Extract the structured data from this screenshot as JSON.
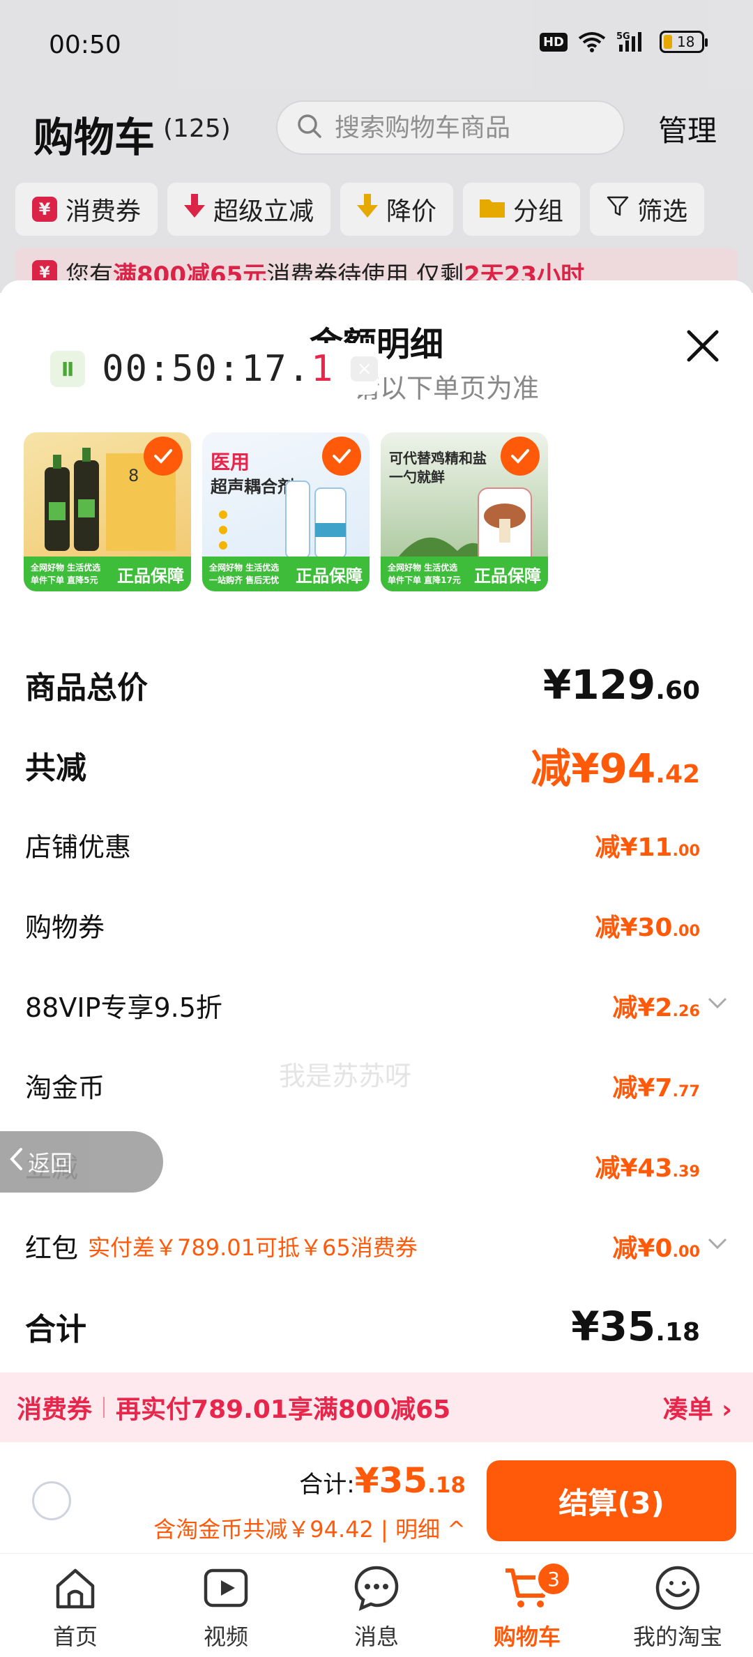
{
  "status": {
    "time": "00:50",
    "hd": "HD",
    "net": "5G",
    "battery": "18"
  },
  "header": {
    "title": "购物车",
    "count": "(125)",
    "search_placeholder": "搜索购物车商品",
    "manage": "管理"
  },
  "filters": [
    {
      "label": "消费券",
      "icon": "coupon-icon",
      "color": "#e8264b"
    },
    {
      "label": "超级立减",
      "icon": "arrow-down-icon",
      "color": "#e8264b"
    },
    {
      "label": "降价",
      "icon": "arrow-down-icon",
      "color": "#f4b400"
    },
    {
      "label": "分组",
      "icon": "folder-icon",
      "color": "#f4b400"
    },
    {
      "label": "筛选",
      "icon": "filter-icon",
      "color": "#222222"
    }
  ],
  "promo": {
    "prefix": "您有",
    "hl1": "满800减65元",
    "mid": "消费券待使用,仅剩",
    "hl2": "2天23小时"
  },
  "sheet": {
    "title": "金额明细",
    "subtitle": "请以下单页为准",
    "timer": "00:50:17.",
    "timer_last": "1",
    "timer_logo": "Ⅱ"
  },
  "products": [
    {
      "name": "product-soysauce",
      "bg": "#f7d68a",
      "tag_l1": "全网好物 生活优选",
      "tag_l2": "单件下单 直降5元",
      "tag_r": "正品保障"
    },
    {
      "name": "product-gel",
      "bg": "#e8f1fb",
      "title": "医用",
      "line": "超声耦合剂",
      "tag_l1": "全网好物 生活优选",
      "tag_l2": "一站购齐 售后无忧",
      "tag_r": "正品保障"
    },
    {
      "name": "product-mushroom",
      "bg": "#d9e7d6",
      "line": "可代替鸡精和盐",
      "line2": "一勺就鲜",
      "tag_l1": "全网好物 生活优选",
      "tag_l2": "单件下单 直降17元",
      "tag_r": "正品保障"
    }
  ],
  "rows": [
    {
      "label": "商品总价",
      "bold": true,
      "value": "¥129",
      "dec": ".60",
      "black": true,
      "big": true
    },
    {
      "label": "共减",
      "bold": true,
      "value": "减¥94",
      "dec": ".42",
      "big": true
    },
    {
      "label": "店铺优惠",
      "value": "减¥11",
      "dec": ".00"
    },
    {
      "label": "购物券",
      "value": "减¥30",
      "dec": ".00"
    },
    {
      "label": "88VIP专享9.5折",
      "value": "减¥2",
      "dec": ".26",
      "chev": true
    },
    {
      "label": "淘金币",
      "value": "减¥7",
      "dec": ".77"
    },
    {
      "label": "立减",
      "value": "减¥43",
      "dec": ".39"
    },
    {
      "label": "红包",
      "note": "实付差￥789.01可抵￥65消费券",
      "value": "减¥0",
      "dec": ".00",
      "chev": true
    },
    {
      "label": "合计",
      "bold": true,
      "value": "¥35",
      "dec": ".18",
      "black": true,
      "big": true
    }
  ],
  "watermark": "我是苏苏呀",
  "back": "返回",
  "voucherbar": {
    "label": "消费券",
    "text": "再实付789.01享满800减65",
    "more": "凑单 ›"
  },
  "footer": {
    "total_label": "合计:",
    "total_int": "¥35",
    "total_dec": ".18",
    "sub": "含淘金币共减￥94.42 | 明细 ^",
    "checkout": "结算(3)"
  },
  "tabs": [
    {
      "label": "首页",
      "icon": "home-icon"
    },
    {
      "label": "视频",
      "icon": "video-icon"
    },
    {
      "label": "消息",
      "icon": "message-icon"
    },
    {
      "label": "购物车",
      "icon": "cart-icon",
      "active": true,
      "badge": "3"
    },
    {
      "label": "我的淘宝",
      "icon": "profile-icon"
    }
  ],
  "colors": {
    "accent": "#ff5a0a",
    "red": "#e8264b"
  }
}
